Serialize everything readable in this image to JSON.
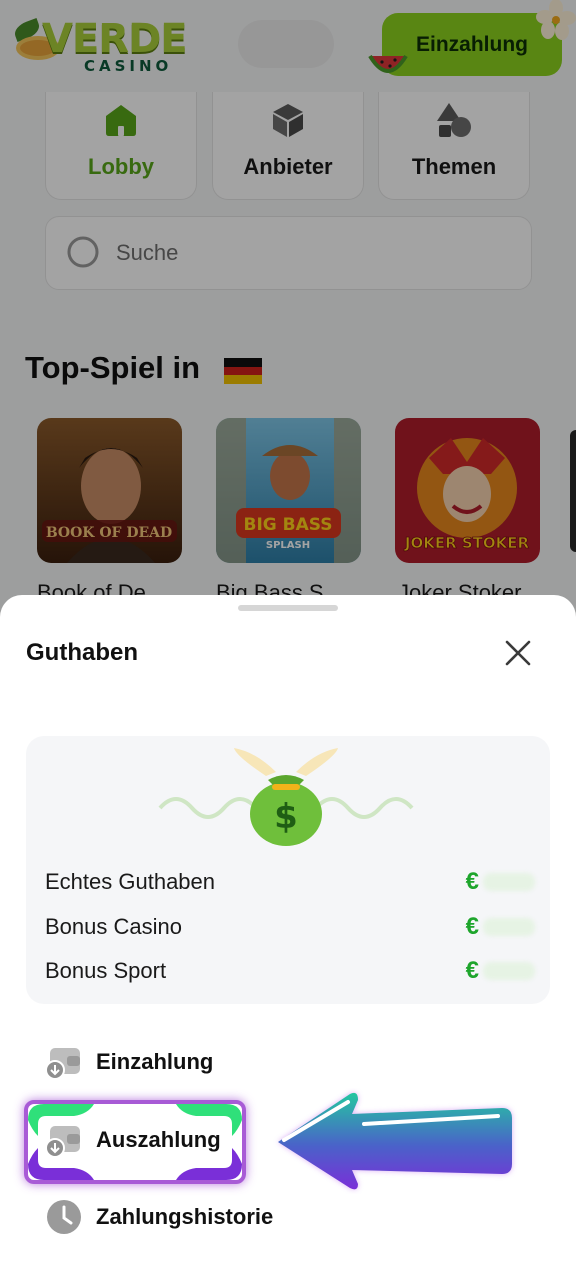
{
  "header": {
    "logo_text": "VERDE",
    "logo_subtext": "CASINO",
    "deposit_button": "Einzahlung"
  },
  "nav": [
    {
      "label": "Lobby",
      "icon": "home-icon",
      "active": true
    },
    {
      "label": "Anbieter",
      "icon": "cube-icon",
      "active": false
    },
    {
      "label": "Themen",
      "icon": "shapes-icon",
      "active": false
    }
  ],
  "search": {
    "placeholder": "Suche"
  },
  "top_games": {
    "title": "Top-Spiel in",
    "flag": "germany-flag-icon",
    "games": [
      {
        "name": "Book of De",
        "art_title": "BOOK OF DEAD"
      },
      {
        "name": "Big Bass S",
        "art_title": "BIG BASS",
        "art_subtitle": "SPLASH"
      },
      {
        "name": "Joker Stoker",
        "art_title": "JOKER STOKER"
      }
    ]
  },
  "sheet": {
    "title": "Guthaben",
    "balances": [
      {
        "label": "Echtes Guthaben",
        "currency": "€"
      },
      {
        "label": "Bonus Casino",
        "currency": "€"
      },
      {
        "label": "Bonus Sport",
        "currency": "€"
      }
    ],
    "menu": [
      {
        "label": "Einzahlung",
        "icon": "wallet-deposit-icon"
      },
      {
        "label": "Auszahlung",
        "icon": "wallet-withdraw-icon"
      },
      {
        "label": "Zahlungshistorie",
        "icon": "clock-icon"
      }
    ]
  },
  "colors": {
    "accent_green": "#8cd21f",
    "euro_green": "#1ea52c",
    "highlight_purple": "#a85bd6"
  }
}
